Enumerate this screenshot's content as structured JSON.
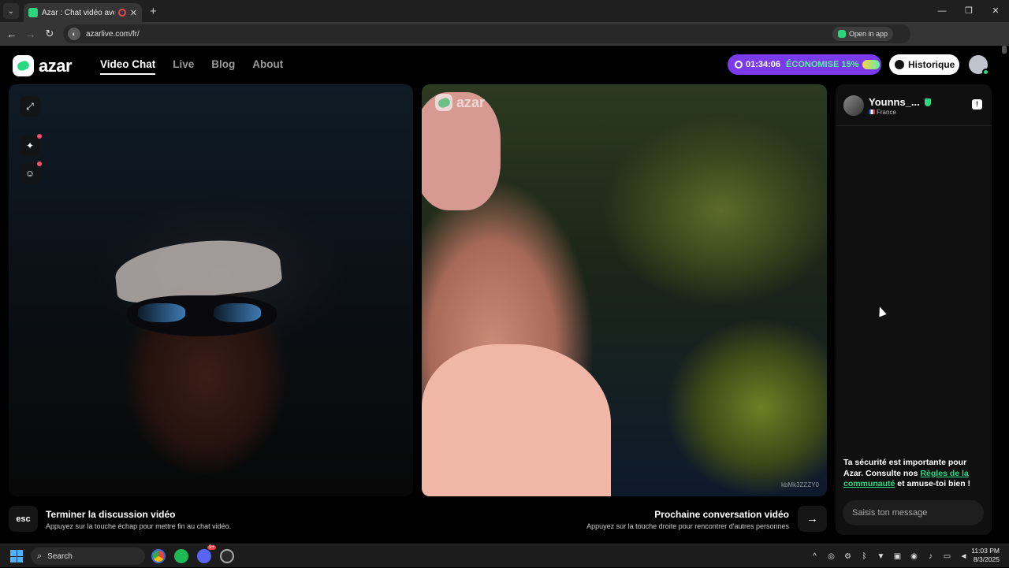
{
  "browser": {
    "tab_title": "Azar : Chat vidéo avec de n",
    "new_tab": "+",
    "url": "azarlive.com/fr/",
    "open_in_app": "Open in app",
    "window_controls": {
      "minimize": "—",
      "restore": "❐",
      "close": "✕"
    },
    "icons": [
      "back-icon",
      "forward-icon",
      "reload-icon",
      "translate-icon",
      "star-icon",
      "extensions-icon",
      "profile-icon",
      "menu-icon"
    ]
  },
  "header": {
    "logo_text": "azar",
    "nav": [
      {
        "label": "Video Chat",
        "active": true
      },
      {
        "label": "Live",
        "active": false
      },
      {
        "label": "Blog",
        "active": false
      },
      {
        "label": "About",
        "active": false
      }
    ],
    "promo": {
      "timer": "01:34:06",
      "save": "ÉCONOMISE 15%"
    },
    "history_label": "Historique"
  },
  "video": {
    "watermark": "azar",
    "remote_code": "kbMk3ZZZY0"
  },
  "chat": {
    "peer_name": "Younns_...",
    "peer_country": "France",
    "safety_prefix": "Ta sécurité est importante pour Azar. Consulte nos ",
    "safety_link": "Règles de la communauté",
    "safety_suffix": " et amuse-toi bien !",
    "message_placeholder": "Saisis ton message"
  },
  "controls": {
    "esc_key": "esc",
    "end_title": "Terminer la discussion vidéo",
    "end_subtitle": "Appuyez sur la touche échap pour mettre fin au chat vidéo.",
    "next_title": "Prochaine conversation vidéo",
    "next_subtitle": "Appuyez sur la touche droite pour rencontrer d'autres personnes",
    "next_arrow": "→"
  },
  "taskbar": {
    "search_label": "Search",
    "discord_badge": "9+",
    "time": "11:03 PM",
    "date": "8/3/2025"
  },
  "colors": {
    "brand_green": "#28d883",
    "promo_purple": "#7c3aed",
    "promo_text_green": "#5cf0a4"
  }
}
